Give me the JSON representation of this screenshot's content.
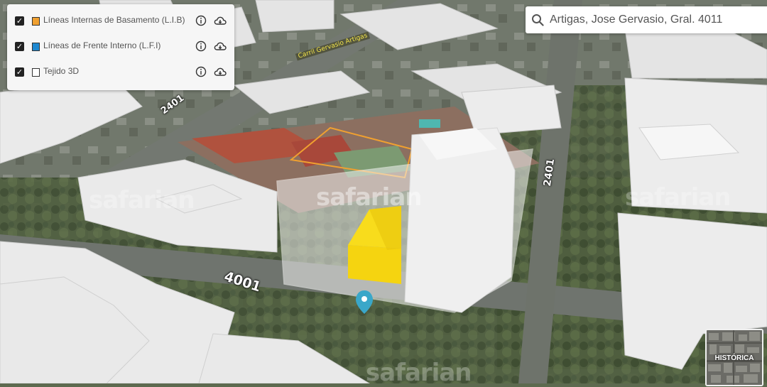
{
  "layers_panel": {
    "items": [
      {
        "label": "Líneas Internas de Basamento (L.I.B)",
        "checked": true,
        "swatch_color": "#f0a030",
        "checkmark": "✓"
      },
      {
        "label": "Líneas de Frente Interno (L.F.I)",
        "checked": true,
        "swatch_color": "#1e88d0",
        "checkmark": "✓"
      },
      {
        "label": "Tejido 3D",
        "checked": true,
        "swatch_color": "#ffffff",
        "checkmark": "✓"
      }
    ],
    "info_icon": "info-icon",
    "cloud_icon": "cloud-download-icon"
  },
  "search": {
    "value": "Artigas, Jose Gervasio, Gral. 4011",
    "icon": "search-icon"
  },
  "map": {
    "street_numbers": [
      "4001",
      "2401",
      "2401"
    ],
    "street_name": "Carril Gervasio Artigas",
    "watermark": "safarian",
    "pin_color": "#3aa7c9",
    "highlight_building_color": "#f5d410"
  },
  "historica_button": {
    "label": "HISTÓRICA"
  }
}
